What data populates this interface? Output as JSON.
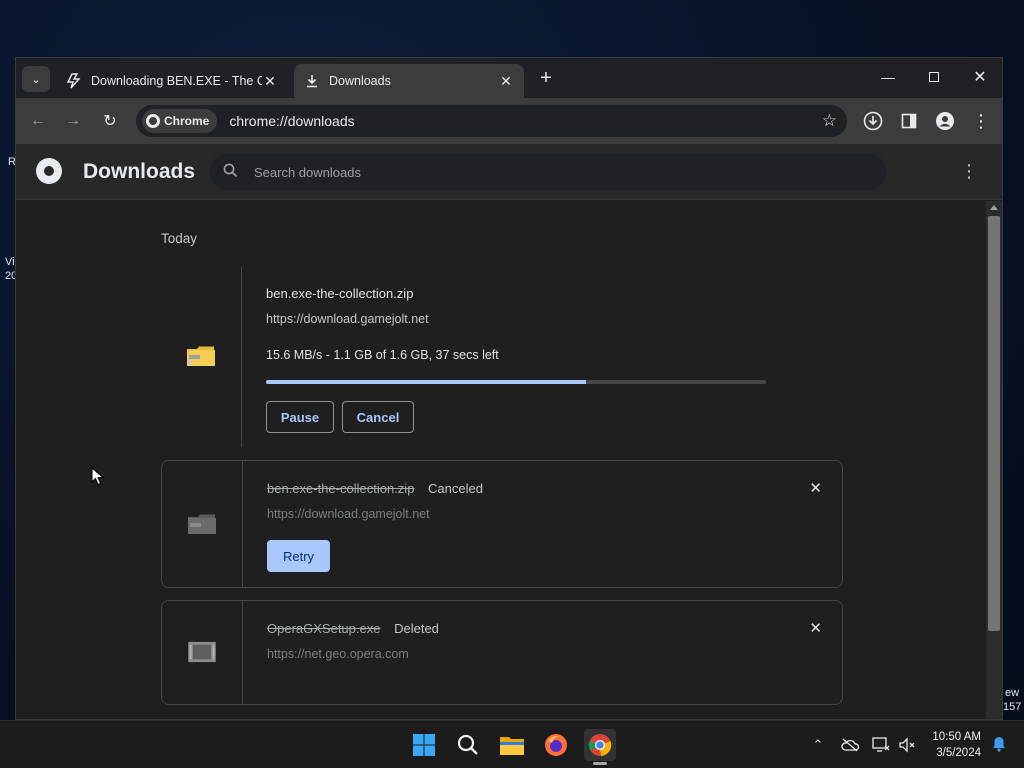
{
  "desktop": {
    "left_fragments": [
      "R",
      "Vi",
      "20"
    ],
    "right_fragments": [
      "ew",
      "157"
    ]
  },
  "tabs": [
    {
      "title": "Downloading BEN.EXE - The Co",
      "icon": "lightning-icon",
      "active": false
    },
    {
      "title": "Downloads",
      "icon": "download-icon",
      "active": true
    }
  ],
  "toolbar": {
    "chip_label": "Chrome",
    "url": "chrome://downloads"
  },
  "downloads_page": {
    "title": "Downloads",
    "search_placeholder": "Search downloads",
    "section_label": "Today",
    "items": [
      {
        "filename": "ben.exe-the-collection.zip",
        "url": "https://download.gamejolt.net",
        "progress_text": "15.6 MB/s - 1.1 GB of 1.6 GB, 37 secs left",
        "progress_fraction": 0.64,
        "buttons": [
          "Pause",
          "Cancel"
        ],
        "icon": "zip-folder-icon"
      },
      {
        "filename": "ben.exe-the-collection.zip",
        "status": "Canceled",
        "url": "https://download.gamejolt.net",
        "button": "Retry",
        "icon": "zip-folder-icon"
      },
      {
        "filename": "OperaGXSetup.exe",
        "status": "Deleted",
        "url": "https://net.geo.opera.com",
        "icon": "exe-file-icon"
      }
    ]
  },
  "taskbar": {
    "apps": [
      "windows-start-icon",
      "search-icon",
      "file-explorer-icon",
      "firefox-icon",
      "chrome-icon"
    ],
    "time": "10:50 AM",
    "date": "3/5/2024"
  },
  "colors": {
    "accent": "#a8c7fa",
    "page_bg": "#1f1f1f",
    "toolbar_bg": "#3c3c3c"
  }
}
